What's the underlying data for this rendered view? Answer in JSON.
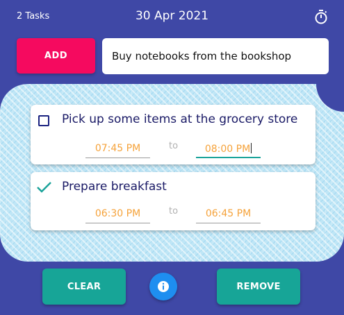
{
  "header": {
    "task_count": "2 Tasks",
    "date": "30 Apr 2021",
    "timer_icon": "stopwatch-icon"
  },
  "composer": {
    "add_label": "ADD",
    "input_value": "Buy notebooks from the bookshop"
  },
  "tasks": [
    {
      "title": "Pick up some items at the grocery store",
      "done": false,
      "start": "07:45 PM",
      "separator": "to",
      "end": "08:00 PM"
    },
    {
      "title": "Prepare breakfast",
      "done": true,
      "start": "06:30 PM",
      "separator": "to",
      "end": "06:45 PM"
    }
  ],
  "footer": {
    "clear_label": "CLEAR",
    "remove_label": "REMOVE",
    "info_icon": "info-icon"
  },
  "colors": {
    "background": "#3f48a6",
    "add_button": "#f50a5f",
    "action_button": "#17a597",
    "info_button": "#1e8ef0",
    "time_text": "#f5a23a",
    "task_text": "#1a1a66"
  }
}
